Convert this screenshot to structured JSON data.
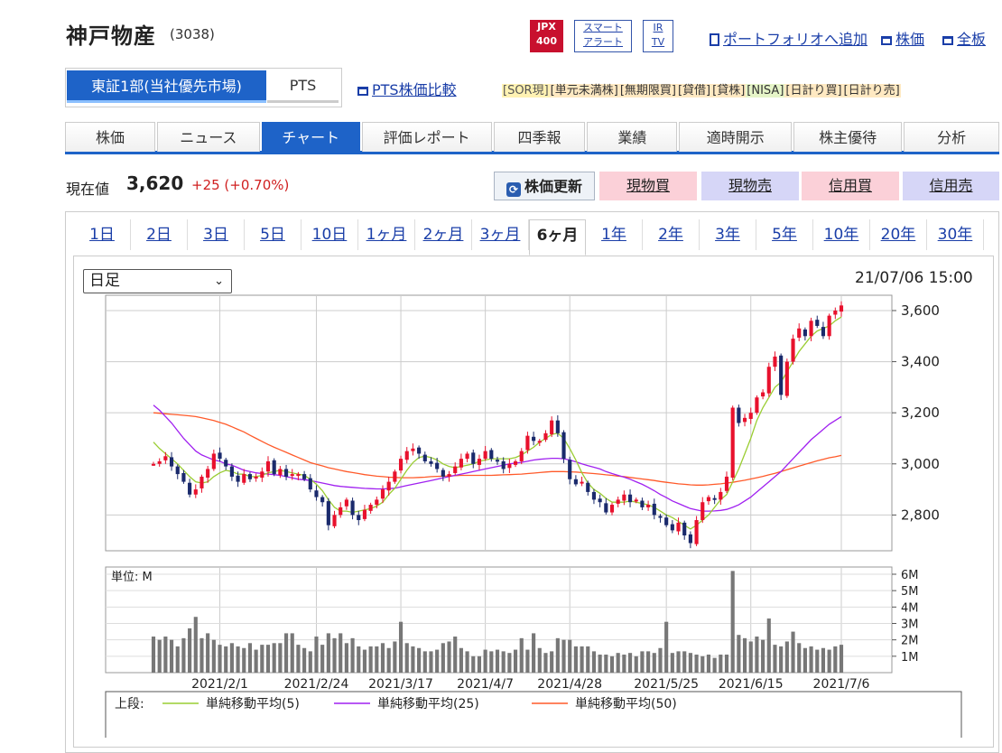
{
  "header": {
    "company_name": "神戸物産",
    "code": "(3038)",
    "badge_jpx": [
      "JPX",
      "400"
    ],
    "badge_smart": [
      "スマート",
      "アラート"
    ],
    "badge_ir": [
      "IR",
      "TV"
    ],
    "add_portfolio": "ポートフォリオへ追加",
    "stock_price_link": "株価",
    "full_view_link": "全板"
  },
  "market": {
    "tse": "東証1部(当社優先市場)",
    "pts": "PTS",
    "pts_compare": "PTS株価比較",
    "tags": [
      "[SOR現]",
      "[単元未満株]",
      "[無期限買]",
      "[貸借]",
      "[貸株]",
      "[NISA]",
      "[日計り買]",
      "[日計り売]"
    ]
  },
  "nav": {
    "tabs": [
      "株価",
      "ニュース",
      "チャート",
      "評価レポート",
      "四季報",
      "業績",
      "適時開示",
      "株主優待",
      "分析"
    ],
    "active": 2
  },
  "price": {
    "label": "現在値",
    "value": "3,620",
    "change": "+25 (+0.70%)"
  },
  "actions": {
    "refresh": "株価更新",
    "buy_cash": "現物買",
    "sell_cash": "現物売",
    "buy_margin": "信用買",
    "sell_margin": "信用売"
  },
  "periods": {
    "items": [
      "1日",
      "2日",
      "3日",
      "5日",
      "10日",
      "1ヶ月",
      "2ヶ月",
      "3ヶ月",
      "6ヶ月",
      "1年",
      "2年",
      "3年",
      "5年",
      "10年",
      "20年",
      "30年"
    ],
    "active": 8
  },
  "chart": {
    "interval_select": "日足",
    "datetime": "21/07/06 15:00",
    "volume_unit": "単位: M",
    "legend_label": "上段:",
    "legend": [
      {
        "name": "単純移動平均(5)",
        "color": "#9acd32"
      },
      {
        "name": "単純移動平均(25)",
        "color": "#a020f0"
      },
      {
        "name": "単純移動平均(50)",
        "color": "#ff5a2a"
      }
    ],
    "colors": {
      "up": "#e8112d",
      "down": "#1a2a6c"
    }
  },
  "chart_data": {
    "type": "candlestick",
    "title": "",
    "x_labels": [
      "2021/2/1",
      "2021/2/24",
      "2021/3/17",
      "2021/4/7",
      "2021/4/28",
      "2021/5/25",
      "2021/6/15",
      "2021/7/6"
    ],
    "ylim": [
      2660,
      3660
    ],
    "y_ticks": [
      "2,800",
      "3,000",
      "3,200",
      "3,400",
      "3,600"
    ],
    "y_tick_values": [
      2800,
      3000,
      3200,
      3400,
      3600
    ],
    "volume_ylim": [
      0,
      6
    ],
    "volume_ticks": [
      "1M",
      "2M",
      "3M",
      "4M",
      "5M",
      "6M"
    ],
    "volume_tick_values": [
      1,
      2,
      3,
      4,
      5,
      6
    ],
    "close": [
      3000,
      3010,
      3030,
      2990,
      2960,
      2930,
      2880,
      2900,
      2950,
      2980,
      3040,
      3020,
      2990,
      2950,
      2930,
      2960,
      2940,
      2950,
      2970,
      3010,
      2960,
      2980,
      2950,
      2960,
      2960,
      2940,
      2900,
      2870,
      2850,
      2760,
      2800,
      2830,
      2860,
      2800,
      2780,
      2820,
      2840,
      2860,
      2900,
      2930,
      2970,
      3020,
      3050,
      3060,
      3040,
      3010,
      3000,
      2980,
      2950,
      2960,
      2990,
      3020,
      3040,
      3000,
      3020,
      3050,
      3020,
      3010,
      2980,
      3000,
      3010,
      3050,
      3110,
      3090,
      3090,
      3120,
      3170,
      3120,
      3020,
      2940,
      2920,
      2930,
      2890,
      2860,
      2850,
      2810,
      2840,
      2860,
      2880,
      2850,
      2860,
      2830,
      2840,
      2800,
      2790,
      2760,
      2740,
      2770,
      2720,
      2690,
      2780,
      2850,
      2870,
      2860,
      2890,
      2950,
      3220,
      3160,
      3180,
      3200,
      3260,
      3280,
      3380,
      3420,
      3270,
      3400,
      3490,
      3530,
      3500,
      3560,
      3540,
      3500,
      3580,
      3600,
      3620
    ],
    "ma5": [
      3085,
      3060,
      3040,
      3020,
      3000,
      2975,
      2950,
      2930,
      2925,
      2930,
      2950,
      2965,
      2975,
      2970,
      2960,
      2960,
      2950,
      2950,
      2955,
      2965,
      2970,
      2975,
      2970,
      2965,
      2960,
      2955,
      2940,
      2920,
      2895,
      2860,
      2830,
      2815,
      2815,
      2810,
      2815,
      2820,
      2825,
      2835,
      2850,
      2880,
      2905,
      2940,
      2975,
      3005,
      3025,
      3030,
      3025,
      3015,
      3000,
      2990,
      2985,
      2990,
      2995,
      3000,
      3010,
      3015,
      3020,
      3020,
      3020,
      3020,
      3025,
      3035,
      3050,
      3065,
      3085,
      3100,
      3115,
      3120,
      3100,
      3060,
      3015,
      2965,
      2925,
      2900,
      2885,
      2865,
      2850,
      2850,
      2850,
      2855,
      2850,
      2845,
      2840,
      2830,
      2815,
      2800,
      2790,
      2775,
      2760,
      2745,
      2760,
      2780,
      2800,
      2830,
      2860,
      2880,
      2930,
      2980,
      3040,
      3100,
      3170,
      3220,
      3260,
      3300,
      3320,
      3360,
      3400,
      3440,
      3470,
      3500,
      3520,
      3530,
      3540,
      3560,
      3575
    ],
    "ma25": [
      3230,
      3210,
      3185,
      3160,
      3130,
      3100,
      3075,
      3050,
      3035,
      3025,
      3015,
      3010,
      3000,
      2995,
      2985,
      2975,
      2970,
      2965,
      2962,
      2960,
      2958,
      2955,
      2950,
      2945,
      2940,
      2938,
      2935,
      2930,
      2925,
      2920,
      2915,
      2912,
      2910,
      2908,
      2906,
      2904,
      2903,
      2902,
      2902,
      2903,
      2905,
      2910,
      2915,
      2920,
      2925,
      2930,
      2935,
      2940,
      2945,
      2950,
      2955,
      2960,
      2965,
      2970,
      2975,
      2980,
      2985,
      2990,
      2995,
      3000,
      3003,
      3006,
      3010,
      3015,
      3018,
      3020,
      3022,
      3022,
      3020,
      3015,
      3008,
      3000,
      2993,
      2987,
      2980,
      2970,
      2962,
      2955,
      2948,
      2940,
      2930,
      2920,
      2908,
      2895,
      2880,
      2868,
      2855,
      2845,
      2835,
      2825,
      2820,
      2815,
      2815,
      2816,
      2818,
      2822,
      2830,
      2840,
      2855,
      2870,
      2890,
      2910,
      2930,
      2950,
      2970,
      2995,
      3020,
      3045,
      3070,
      3095,
      3115,
      3135,
      3155,
      3170,
      3185
    ],
    "ma50": [
      3200,
      3198,
      3196,
      3194,
      3192,
      3190,
      3188,
      3185,
      3180,
      3175,
      3170,
      3162,
      3155,
      3145,
      3135,
      3125,
      3112,
      3100,
      3088,
      3076,
      3065,
      3055,
      3045,
      3035,
      3025,
      3015,
      3005,
      2998,
      2992,
      2985,
      2980,
      2975,
      2970,
      2966,
      2962,
      2958,
      2955,
      2952,
      2950,
      2948,
      2947,
      2946,
      2946,
      2946,
      2947,
      2948,
      2950,
      2951,
      2952,
      2953,
      2954,
      2955,
      2955,
      2955,
      2955,
      2955,
      2955,
      2956,
      2957,
      2958,
      2959,
      2960,
      2962,
      2964,
      2966,
      2968,
      2970,
      2970,
      2970,
      2969,
      2968,
      2966,
      2964,
      2962,
      2960,
      2957,
      2955,
      2952,
      2950,
      2947,
      2944,
      2941,
      2938,
      2935,
      2931,
      2928,
      2925,
      2922,
      2920,
      2918,
      2917,
      2917,
      2918,
      2920,
      2922,
      2925,
      2928,
      2932,
      2936,
      2941,
      2946,
      2951,
      2957,
      2963,
      2970,
      2977,
      2984,
      2991,
      2998,
      3005,
      3012,
      3018,
      3024,
      3028,
      3033
    ],
    "volume": [
      2.2,
      2.0,
      2.2,
      2.0,
      1.6,
      2.1,
      2.7,
      3.4,
      2.1,
      2.4,
      2.0,
      1.7,
      1.6,
      1.8,
      1.6,
      1.5,
      1.8,
      1.4,
      1.7,
      1.7,
      1.8,
      1.8,
      2.4,
      2.4,
      1.7,
      1.5,
      1.3,
      2.2,
      1.7,
      2.4,
      2.1,
      2.4,
      1.8,
      2.1,
      1.6,
      1.4,
      1.6,
      1.6,
      1.8,
      1.5,
      1.9,
      3.1,
      1.8,
      1.6,
      1.5,
      1.3,
      1.3,
      1.4,
      1.8,
      1.9,
      2.2,
      1.5,
      1.3,
      1.0,
      1.0,
      1.4,
      1.3,
      1.4,
      1.3,
      1.2,
      1.4,
      2.1,
      1.4,
      2.4,
      1.5,
      1.2,
      1.3,
      2.1,
      2.0,
      2.0,
      1.6,
      1.6,
      1.6,
      1.3,
      1.1,
      1.1,
      1.0,
      1.2,
      1.1,
      1.2,
      1.0,
      1.3,
      1.3,
      1.2,
      1.5,
      3.1,
      1.2,
      1.3,
      1.3,
      1.2,
      1.1,
      1.0,
      1.1,
      0.9,
      1.1,
      1.1,
      6.2,
      2.3,
      2.1,
      1.9,
      2.2,
      2.0,
      3.3,
      1.7,
      1.6,
      1.9,
      2.5,
      1.8,
      1.5,
      1.6,
      1.4,
      1.5,
      1.4,
      1.6,
      1.7
    ]
  }
}
